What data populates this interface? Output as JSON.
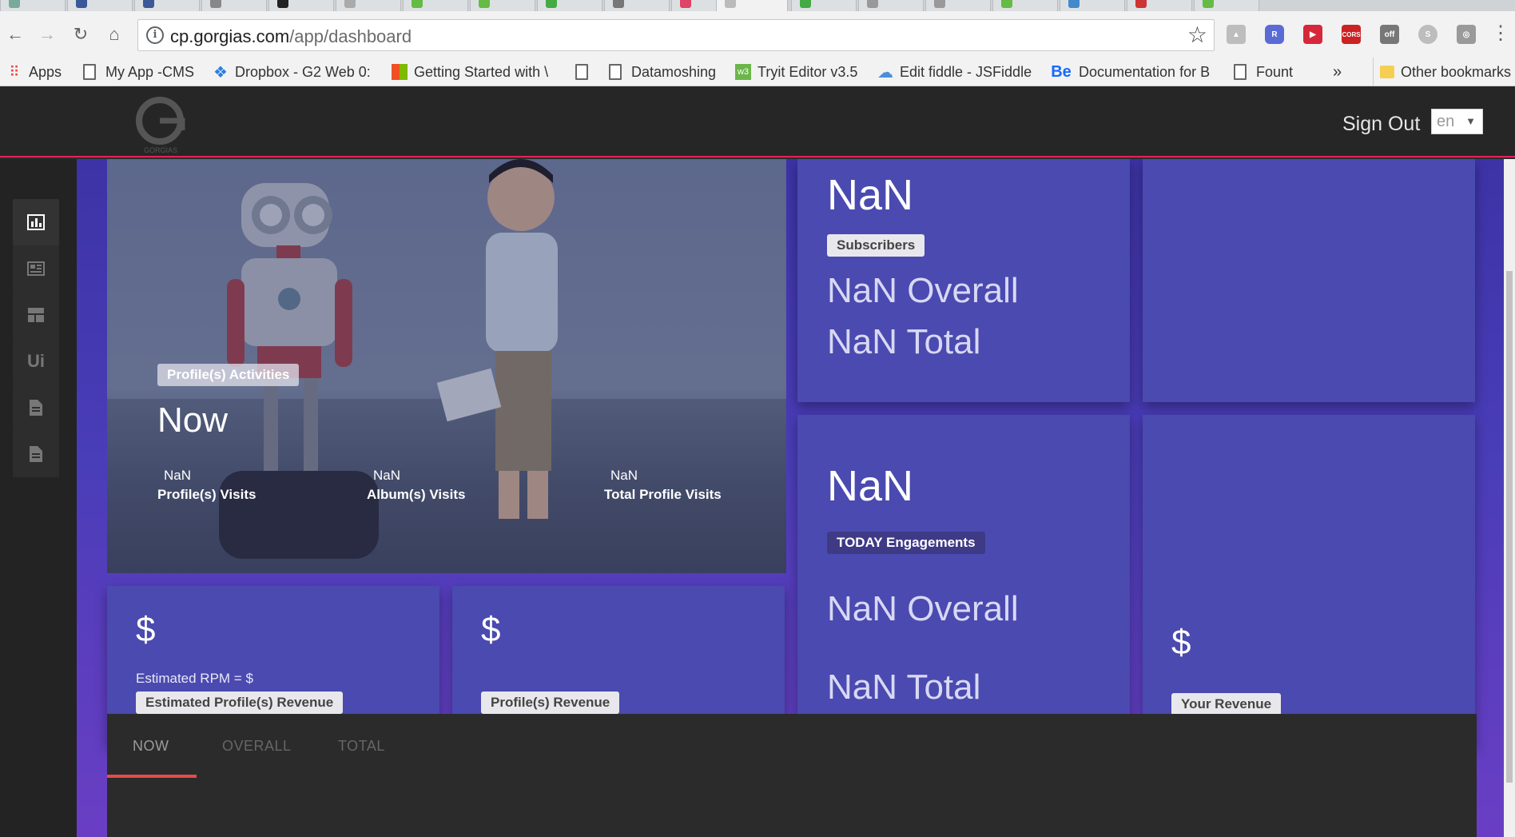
{
  "browser": {
    "url_host": "cp.gorgias.com",
    "url_path": "/app/dashboard",
    "bookmarks": [
      {
        "label": "Apps"
      },
      {
        "label": "My App -CMS"
      },
      {
        "label": "Dropbox - G2 Web 0:"
      },
      {
        "label": "Getting Started with \\"
      },
      {
        "label": ""
      },
      {
        "label": "Datamoshing"
      },
      {
        "label": "Tryit Editor v3.5"
      },
      {
        "label": "Edit fiddle - JSFiddle"
      },
      {
        "label": "Documentation for B"
      },
      {
        "label": "Fount"
      }
    ],
    "overflow_label": "»",
    "other_bookmarks": "Other bookmarks"
  },
  "header": {
    "brand": "GORGIAS",
    "sign_out": "Sign Out",
    "language": "en"
  },
  "sidebar": {
    "items": [
      {
        "icon": "bar-chart-icon",
        "glyph": "▥",
        "active": true
      },
      {
        "icon": "newspaper-icon",
        "glyph": "▤",
        "active": false
      },
      {
        "icon": "layout-icon",
        "glyph": "▦",
        "active": false
      },
      {
        "icon": "ui-icon",
        "glyph": "Ui",
        "active": false
      },
      {
        "icon": "document-icon",
        "glyph": "▤",
        "active": false
      },
      {
        "icon": "document-icon",
        "glyph": "▤",
        "active": false
      }
    ]
  },
  "hero": {
    "badge": "Profile(s) Activities",
    "period": "Now",
    "stats": [
      {
        "value": "NaN",
        "label": "Profile(s) Visits"
      },
      {
        "value": "NaN",
        "label": "Album(s) Visits"
      },
      {
        "value": "NaN",
        "label": "Total Profile Visits"
      }
    ]
  },
  "subscribers_card": {
    "value": "NaN",
    "badge": "Subscribers",
    "overall": "NaN Overall",
    "total": "NaN Total"
  },
  "engagements_card": {
    "value": "NaN",
    "badge": "TODAY Engagements",
    "overall": "NaN Overall",
    "total": "NaN Total"
  },
  "revenue_cards": {
    "estimated": {
      "amount": "$",
      "rpm": "Estimated RPM = $",
      "badge": "Estimated Profile(s) Revenue"
    },
    "profile": {
      "amount": "$",
      "badge": "Profile(s) Revenue"
    },
    "yours": {
      "amount": "$",
      "badge": "Your Revenue"
    }
  },
  "bottom_tabs": [
    {
      "label": "NOW",
      "active": true
    },
    {
      "label": "OVERALL",
      "active": false
    },
    {
      "label": "TOTAL",
      "active": false
    }
  ],
  "colors": {
    "accent": "#e0245e",
    "tab_underline": "#e34b4b",
    "card": "#4a4ab0"
  }
}
